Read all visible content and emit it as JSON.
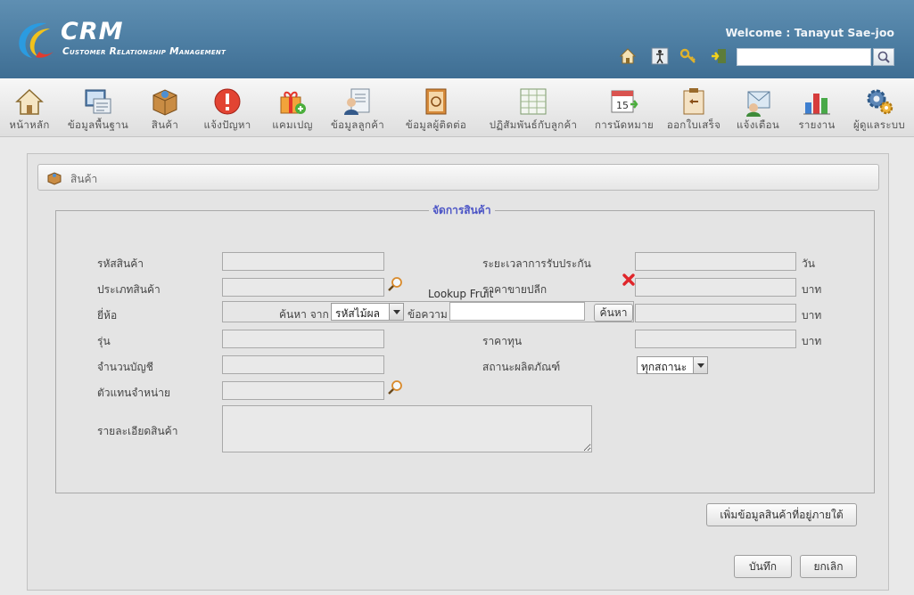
{
  "header": {
    "app_name": "CRM",
    "app_subtitle": "Customer Relationship Management",
    "welcome_text": "Welcome : Tanayut Sae-joo",
    "search_placeholder": ""
  },
  "menu": {
    "items": [
      {
        "label": "หน้าหลัก",
        "icon": "home-icon"
      },
      {
        "label": "ข้อมูลพื้นฐาน",
        "icon": "basic-data-icon"
      },
      {
        "label": "สินค้า",
        "icon": "product-box-icon"
      },
      {
        "label": "แจ้งปัญหา",
        "icon": "alert-icon"
      },
      {
        "label": "แคมเปญ",
        "icon": "gift-campaign-icon"
      },
      {
        "label": "ข้อมูลลูกค้า",
        "icon": "customer-card-icon"
      },
      {
        "label": "ข้อมูลผู้ติดต่อ",
        "icon": "address-book-icon"
      },
      {
        "label": "ปฏิสัมพันธ์กับลูกค้า",
        "icon": "interaction-grid-icon"
      },
      {
        "label": "การนัดหมาย",
        "icon": "calendar-icon"
      },
      {
        "label": "ออกใบเสร็จ",
        "icon": "receipt-icon"
      },
      {
        "label": "แจ้งเตือน",
        "icon": "notification-icon"
      },
      {
        "label": "รายงาน",
        "icon": "bar-chart-icon"
      },
      {
        "label": "ผู้ดูแลระบบ",
        "icon": "admin-gear-icon"
      }
    ]
  },
  "page": {
    "title": "สินค้า",
    "group_legend": "จัดการสินค้า",
    "fields": {
      "product_code": "รหัสสินค้า",
      "product_type": "ประเภทสินค้า",
      "brand": "ยี่ห้อ",
      "model": "รุ่น",
      "accounting_count": "จำนวนบัญชี",
      "distributor": "ตัวแทนจำหน่าย",
      "description": "รายละเอียดสินค้า",
      "warranty": "ระยะเวลาการรับประกัน",
      "retail_price": "ราคาขายปลีก",
      "cost_price": "ราคาทุน",
      "product_status": "สถานะผลิตภัณฑ์"
    },
    "units": {
      "day": "วัน",
      "baht": "บาท"
    },
    "status_select_value": "ทุกสถานะ",
    "add_subproduct_button": "เพิ่มข้อมูลสินค้าที่อยู่ภายใต้",
    "save_button": "บันทึก",
    "cancel_button": "ยกเลิก"
  },
  "lookup": {
    "title": "Lookup Fruit",
    "search_from_label": "ค้นหา จาก",
    "search_by_value": "รหัสไม้ผล",
    "text_label": "ข้อความ",
    "text_value": "",
    "search_button": "ค้นหา"
  }
}
